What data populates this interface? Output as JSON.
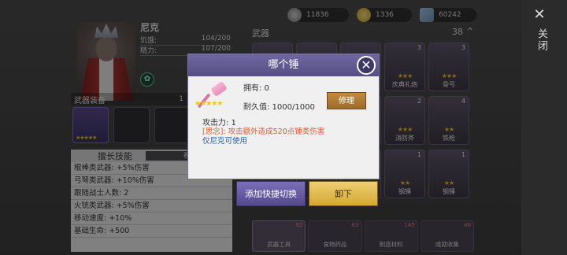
{
  "character": {
    "name": "尼克",
    "stats": [
      {
        "label": "饥饿:",
        "value": "104/200"
      },
      {
        "label": "精力:",
        "value": "107/200"
      }
    ],
    "equip_header": "武器装备",
    "equip_count": "1",
    "skills_title": "擅长技能",
    "skills_badge": "祝",
    "skills": [
      "棍棒类武器: +5%伤害",
      "弓弩类武器: +10%伤害",
      "跟随战士人数: 2",
      "火铳类武器: +5%伤害",
      "移动速度: +10%",
      "基础生命: +500"
    ]
  },
  "resources": {
    "r1": "11836",
    "r2": "1336",
    "r3": "60242"
  },
  "weapons": {
    "header": "武器",
    "count": "38",
    "items": [
      {
        "label": "",
        "num": "",
        "stars": ""
      },
      {
        "label": "",
        "num": "",
        "stars": ""
      },
      {
        "label": "",
        "num": "",
        "stars": ""
      },
      {
        "label": "庆典礼炮",
        "num": "3",
        "stars": "★★★"
      },
      {
        "label": "骨弓",
        "num": "3",
        "stars": "★★★"
      },
      {
        "label": "",
        "num": "",
        "stars": ""
      },
      {
        "label": "",
        "num": "",
        "stars": ""
      },
      {
        "label": "",
        "num": "",
        "stars": ""
      },
      {
        "label": "消防斧",
        "num": "2",
        "stars": "★★★"
      },
      {
        "label": "铁枪",
        "num": "4",
        "stars": "★★"
      },
      {
        "label": "",
        "num": "",
        "stars": ""
      },
      {
        "label": "",
        "num": "",
        "stars": ""
      },
      {
        "label": "",
        "num": "",
        "stars": ""
      },
      {
        "label": "钢锤",
        "num": "1",
        "stars": "★★"
      },
      {
        "label": "钢锤",
        "num": "1",
        "stars": "★★"
      }
    ],
    "tabs": [
      {
        "label": "武器工具",
        "num": "92"
      },
      {
        "label": "食物药品",
        "num": "63"
      },
      {
        "label": "制造材料",
        "num": "145"
      },
      {
        "label": "成就收集",
        "num": "46"
      }
    ]
  },
  "side": {
    "close_label": "关闭"
  },
  "dialog": {
    "title": "哪个锤",
    "owned": "拥有: 0",
    "durability": "耐久值: 1000/1000",
    "repair": "修理",
    "attack": "攻击力: 1",
    "passive": "[思念]: 攻击额外造成520点锤类伤害",
    "only": "仅尼克可使用",
    "stars": "★★★★★",
    "quick_switch": "添加快捷切换",
    "unequip": "卸下"
  },
  "colors": {
    "accent_purple": "#564f86",
    "gold": "#f3c12c",
    "passive_red": "#e05a38",
    "info_blue": "#2c5fa0"
  }
}
